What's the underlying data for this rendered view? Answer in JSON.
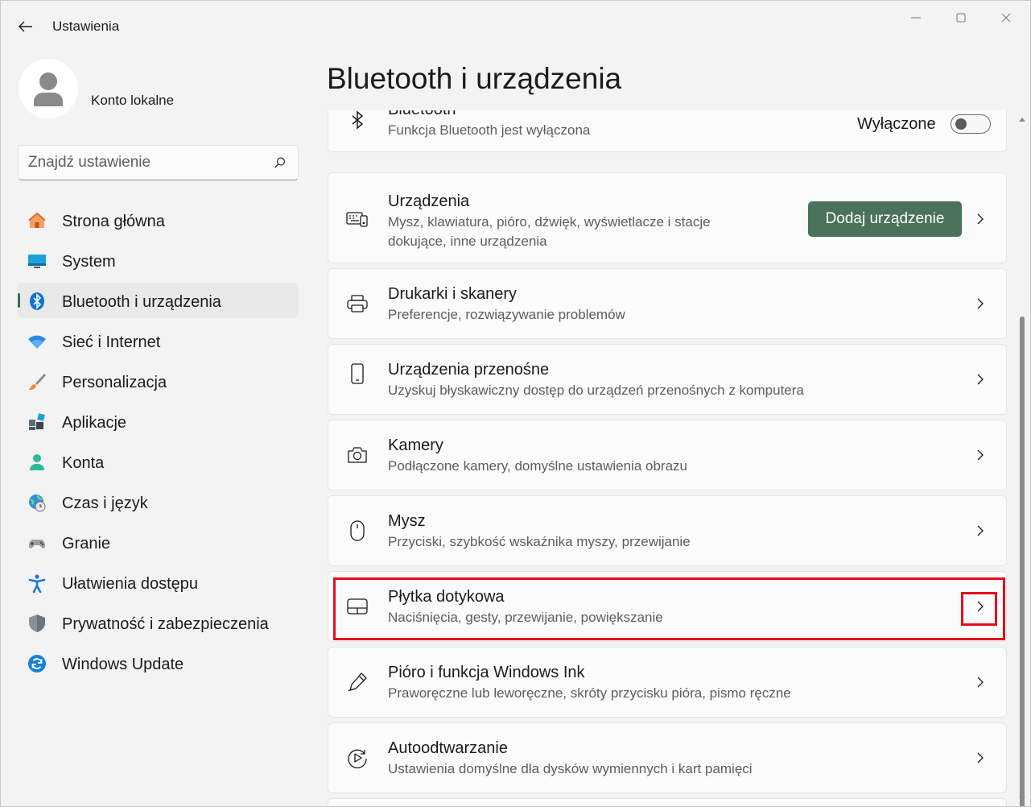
{
  "window": {
    "title": "Ustawienia",
    "controls": [
      "minimize-icon",
      "maximize-icon",
      "close-icon"
    ]
  },
  "profile": {
    "account_name": "Konto lokalne"
  },
  "search": {
    "placeholder": "Znajdź ustawienie",
    "value": ""
  },
  "nav": {
    "active_index": 2,
    "accent_color": "#3d6b55",
    "items": [
      {
        "label": "Strona główna",
        "icon": "home-icon"
      },
      {
        "label": "System",
        "icon": "system-display-icon"
      },
      {
        "label": "Bluetooth i urządzenia",
        "icon": "bluetooth-icon"
      },
      {
        "label": "Sieć i Internet",
        "icon": "wifi-icon"
      },
      {
        "label": "Personalizacja",
        "icon": "brush-icon"
      },
      {
        "label": "Aplikacje",
        "icon": "apps-icon"
      },
      {
        "label": "Konta",
        "icon": "person-icon"
      },
      {
        "label": "Czas i język",
        "icon": "globe-clock-icon"
      },
      {
        "label": "Granie",
        "icon": "gamepad-icon"
      },
      {
        "label": "Ułatwienia dostępu",
        "icon": "accessibility-icon"
      },
      {
        "label": "Prywatność i zabezpieczenia",
        "icon": "shield-icon"
      },
      {
        "label": "Windows Update",
        "icon": "update-icon"
      }
    ]
  },
  "main": {
    "title": "Bluetooth i urządzenia",
    "bluetooth": {
      "title": "Bluetooth",
      "desc": "Funkcja Bluetooth jest wyłączona",
      "toggle_label": "Wyłączone",
      "toggle_on": false
    },
    "devices": {
      "title": "Urządzenia",
      "desc": "Mysz, klawiatura, pióro, dźwięk, wyświetlacze i stacje dokujące, inne urządzenia",
      "button_label": "Dodaj urządzenie"
    },
    "rows": [
      {
        "title": "Drukarki i skanery",
        "desc": "Preferencje, rozwiązywanie problemów",
        "icon": "printer-icon"
      },
      {
        "title": "Urządzenia przenośne",
        "desc": "Uzyskuj błyskawiczny dostęp do urządzeń przenośnych z komputera",
        "icon": "phone-icon"
      },
      {
        "title": "Kamery",
        "desc": "Podłączone kamery, domyślne ustawienia obrazu",
        "icon": "camera-icon"
      },
      {
        "title": "Mysz",
        "desc": "Przyciski, szybkość wskaźnika myszy, przewijanie",
        "icon": "mouse-icon"
      },
      {
        "title": "Płytka dotykowa",
        "desc": "Naciśnięcia, gesty, przewijanie, powiększanie",
        "icon": "touchpad-icon"
      },
      {
        "title": "Pióro i funkcja Windows Ink",
        "desc": "Praworęczne lub leworęczne, skróty przycisku pióra, pismo ręczne",
        "icon": "pen-icon"
      },
      {
        "title": "Autoodtwarzanie",
        "desc": "Ustawienia domyślne dla dysków wymiennych i kart pamięci",
        "icon": "autoplay-icon"
      }
    ]
  },
  "highlight": {
    "color": "#e3101e",
    "target": "Płytka dotykowa"
  }
}
